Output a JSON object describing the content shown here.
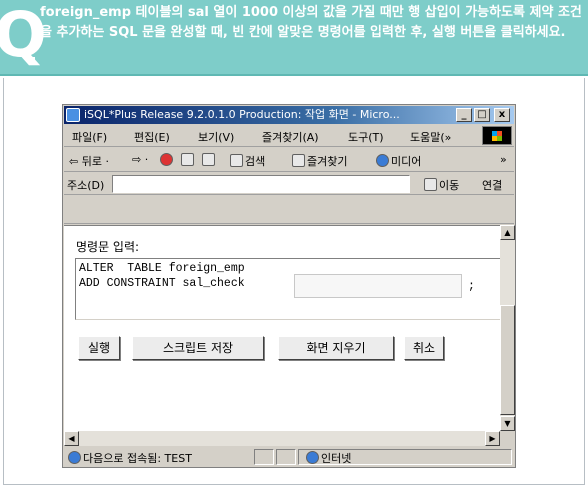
{
  "question": {
    "letter": "Q",
    "text": "foreign_emp 테이블의 sal 열이 1000 이상의 값을 가질 때만 행 삽입이 가능하도록 제약 조건을 추가하는 SQL 문을 완성할 때, 빈 칸에 알맞은 명령어를 입력한 후, 실행 버튼을 클릭하세요."
  },
  "window": {
    "title": "iSQL*Plus Release 9.2.0.1.0 Production: 작업 화면 - Micro...",
    "min": "_",
    "max": "□",
    "close": "x"
  },
  "menu": [
    {
      "label": "파일(F)"
    },
    {
      "label": "편집(E)"
    },
    {
      "label": "보기(V)"
    },
    {
      "label": "즐겨찾기(A)"
    },
    {
      "label": "도구(T)"
    },
    {
      "label": "도움말(»"
    }
  ],
  "toolbar": {
    "back": "⇦ 뒤로 ·",
    "forward": "⇨ ·",
    "search": "검색",
    "favorites": "즐겨찾기",
    "media": "미디어",
    "more": "»"
  },
  "address": {
    "label": "주소(D)",
    "value": "",
    "go": "이동",
    "links": "연결"
  },
  "editor": {
    "label": "명령문 입력:",
    "line1": "ALTER  TABLE foreign_emp",
    "line2": "ADD CONSTRAINT sal_check",
    "blank_value": "",
    "semicolon": ";"
  },
  "buttons": {
    "execute": "실행",
    "save_script": "스크립트 저장",
    "clear_screen": "화면 지우기",
    "cancel": "취소"
  },
  "status": {
    "text": "다음으로 접속됨: TEST",
    "zone": "인터넷"
  }
}
